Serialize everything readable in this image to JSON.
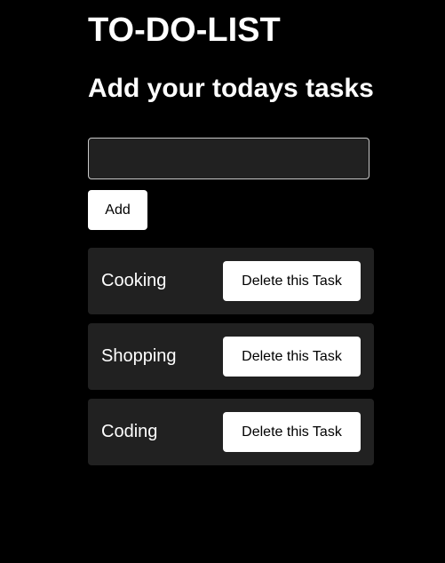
{
  "header": {
    "title": "TO-DO-LIST",
    "subtitle": "Add your todays tasks"
  },
  "form": {
    "input_value": "",
    "add_label": "Add"
  },
  "tasks": [
    {
      "label": "Cooking",
      "delete_label": "Delete this Task"
    },
    {
      "label": "Shopping",
      "delete_label": "Delete this Task"
    },
    {
      "label": "Coding",
      "delete_label": "Delete this Task"
    }
  ],
  "colors": {
    "background": "#000000",
    "card": "#212121",
    "button": "#ffffff",
    "text": "#ffffff"
  }
}
